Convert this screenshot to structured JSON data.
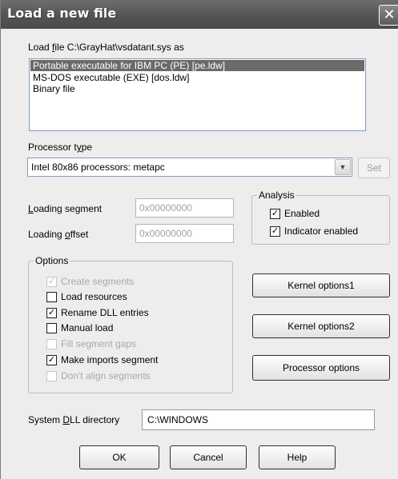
{
  "window": {
    "title": "Load a new file",
    "close_glyph": "✕"
  },
  "file": {
    "label_prefix": "Load ",
    "label_accel": "f",
    "label_suffix": "ile C:\\GrayHat\\vsdatant.sys as",
    "types": [
      {
        "label": "Portable executable for IBM PC (PE) [pe.ldw]",
        "selected": true
      },
      {
        "label": "MS-DOS executable (EXE) [dos.ldw]",
        "selected": false
      },
      {
        "label": "Binary file",
        "selected": false
      }
    ]
  },
  "processor": {
    "label_prefix": "Processor t",
    "label_accel": "y",
    "label_suffix": "pe",
    "selected": "Intel 80x86 processors: metapc",
    "dropdown_icon": "chevron-down-icon",
    "set_label": "Set"
  },
  "loading": {
    "segment_accel": "L",
    "segment_suffix": "oading segment",
    "segment_value": "0x00000000",
    "offset_prefix": "Loading ",
    "offset_accel": "o",
    "offset_suffix": "ffset",
    "offset_value": "0x00000000"
  },
  "analysis": {
    "title": "Analysis",
    "enabled_label": "Enabled",
    "enabled_checked": true,
    "indicator_label": "Indicator enabled",
    "indicator_checked": true
  },
  "options": {
    "title": "Options",
    "items": [
      {
        "label": "Create segments",
        "checked": true,
        "disabled": true
      },
      {
        "label": "Load resources",
        "checked": false,
        "disabled": false
      },
      {
        "label": "Rename DLL entries",
        "checked": true,
        "disabled": false
      },
      {
        "label": "Manual load",
        "checked": false,
        "disabled": false
      },
      {
        "label": "Fill segment gaps",
        "checked": false,
        "disabled": true
      },
      {
        "label": "Make imports segment",
        "checked": true,
        "disabled": false
      },
      {
        "label": "Don't align segments",
        "checked": false,
        "disabled": true
      }
    ],
    "check_glyph": "✓"
  },
  "side_buttons": {
    "kernel1": "Kernel options1",
    "kernel2": "Kernel options2",
    "processor": "Processor options"
  },
  "dll": {
    "label_prefix": "System ",
    "label_accel": "D",
    "label_suffix": "LL directory",
    "value": "C:\\WINDOWS"
  },
  "footer": {
    "ok": "OK",
    "cancel": "Cancel",
    "help": "Help"
  }
}
